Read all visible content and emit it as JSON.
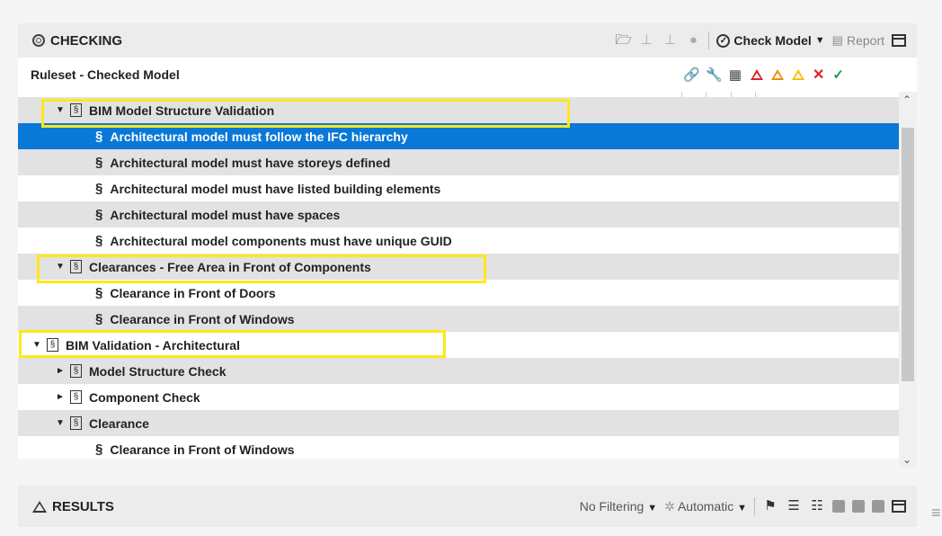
{
  "checking": {
    "title": "CHECKING",
    "check_model_label": "Check Model",
    "report_label": "Report"
  },
  "columns": {
    "ruleset_label": "Ruleset - Checked Model"
  },
  "tree": [
    {
      "label": "BIM Model Structure Validation",
      "kind": "ruleset",
      "expanded": true,
      "indent": 1
    },
    {
      "label": "Architectural model must follow the IFC hierarchy",
      "kind": "rule",
      "selected": true,
      "indent": 2
    },
    {
      "label": "Architectural model must have storeys defined",
      "kind": "rule",
      "indent": 2
    },
    {
      "label": "Architectural model must have listed building elements",
      "kind": "rule",
      "indent": 2
    },
    {
      "label": "Architectural model must have spaces",
      "kind": "rule",
      "indent": 2
    },
    {
      "label": "Architectural model components must have unique GUID",
      "kind": "rule",
      "indent": 2
    },
    {
      "label": "Clearances - Free Area in Front of Components",
      "kind": "ruleset",
      "expanded": true,
      "indent": 1
    },
    {
      "label": "Clearance in Front of Doors",
      "kind": "rule",
      "indent": 2
    },
    {
      "label": "Clearance in Front of Windows",
      "kind": "rule",
      "indent": 2
    },
    {
      "label": "BIM Validation - Architectural",
      "kind": "ruleset",
      "expanded": true,
      "indent": 0
    },
    {
      "label": "Model Structure Check",
      "kind": "ruleset",
      "expanded": false,
      "indent": 1
    },
    {
      "label": "Component Check",
      "kind": "ruleset",
      "expanded": false,
      "indent": 1
    },
    {
      "label": "Clearance",
      "kind": "ruleset",
      "expanded": true,
      "indent": 1
    },
    {
      "label": "Clearance in Front of Windows",
      "kind": "rule",
      "indent": 2
    }
  ],
  "results": {
    "title": "RESULTS",
    "filter_label": "No Filtering",
    "mode_label": "Automatic"
  },
  "icons": {
    "rule_symbol": "§",
    "ruleset_symbol": "§",
    "caret_expanded": "▼",
    "caret_collapsed": "►"
  },
  "colors": {
    "selection": "#0a78d7",
    "highlight": "#ffe81a",
    "critical": "#e0202a",
    "major": "#f08c00",
    "moderate": "#f2c200",
    "ok": "#12a050"
  }
}
